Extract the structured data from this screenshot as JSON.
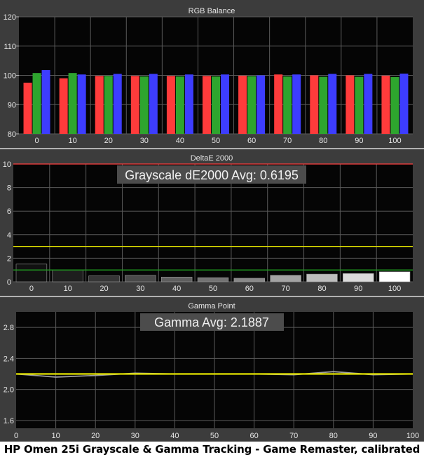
{
  "caption": "HP Omen 25i Grayscale & Gamma Tracking - Game Remaster, calibrated",
  "chart_data": [
    {
      "type": "bar",
      "title": "RGB Balance",
      "categories": [
        "0",
        "10",
        "20",
        "30",
        "40",
        "50",
        "60",
        "70",
        "80",
        "90",
        "100"
      ],
      "ylim": [
        80,
        120
      ],
      "yticks": [
        80,
        90,
        100,
        110,
        120
      ],
      "grid": true,
      "series": [
        {
          "color": "#ff3b3b",
          "values": [
            97.5,
            99.0,
            99.8,
            99.8,
            99.8,
            99.8,
            99.9,
            100.3,
            100.0,
            100.0,
            99.9
          ]
        },
        {
          "color": "#2ea52e",
          "values": [
            100.8,
            100.8,
            99.8,
            99.6,
            99.6,
            99.6,
            99.7,
            99.6,
            99.5,
            99.5,
            99.4
          ]
        },
        {
          "color": "#3d3dff",
          "values": [
            101.8,
            100.3,
            100.5,
            100.5,
            100.3,
            100.3,
            100.0,
            100.3,
            100.5,
            100.5,
            100.6
          ]
        }
      ]
    },
    {
      "type": "bar",
      "title": "DeltaE 2000",
      "annotation": "Grayscale dE2000 Avg: 0.6195",
      "categories": [
        "0",
        "10",
        "20",
        "30",
        "40",
        "50",
        "60",
        "70",
        "80",
        "90",
        "100"
      ],
      "ylim": [
        0,
        10
      ],
      "yticks": [
        0,
        2,
        4,
        6,
        8,
        10
      ],
      "grid": true,
      "values": [
        1.5,
        1.0,
        0.5,
        0.55,
        0.4,
        0.35,
        0.3,
        0.55,
        0.65,
        0.7,
        0.85
      ],
      "bar_colors": [
        "#111111",
        "#1e1e1e",
        "#363636",
        "#4a4a4a",
        "#5e5e5e",
        "#737373",
        "#888888",
        "#a3a3a3",
        "#bdbdbd",
        "#dadada",
        "#ffffff"
      ],
      "reference_lines": [
        {
          "value": 10,
          "color": "#ff4040"
        },
        {
          "value": 3,
          "color": "#e0e000"
        },
        {
          "value": 1,
          "color": "#1f9a1f"
        }
      ]
    },
    {
      "type": "line",
      "title": "Gamma Point",
      "annotation": "Gamma Avg: 2.1887",
      "x": [
        0,
        10,
        20,
        30,
        40,
        50,
        60,
        70,
        80,
        90,
        100
      ],
      "xlim": [
        0,
        100
      ],
      "ylim": [
        1.5,
        3.0
      ],
      "yticks": [
        1.6,
        2.0,
        2.4,
        2.8
      ],
      "grid": true,
      "series": [
        {
          "color": "#9e9e9e",
          "values": [
            2.2,
            2.16,
            2.18,
            2.21,
            2.2,
            2.2,
            2.2,
            2.19,
            2.23,
            2.19,
            2.2
          ]
        },
        {
          "color": "#e6e600",
          "values": [
            2.2,
            2.2,
            2.2,
            2.2,
            2.2,
            2.2,
            2.2,
            2.2,
            2.2,
            2.2,
            2.2
          ]
        }
      ]
    }
  ]
}
